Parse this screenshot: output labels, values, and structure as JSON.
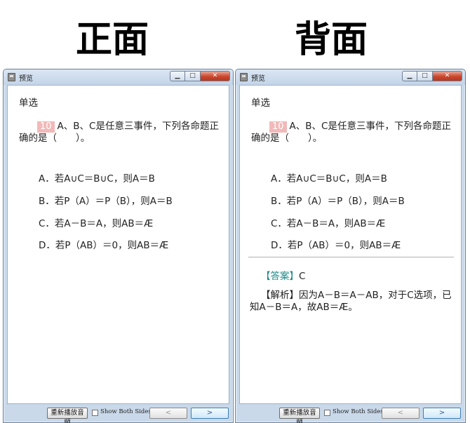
{
  "headings": {
    "front": "正面",
    "back": "背面"
  },
  "window": {
    "title": "预览",
    "controls": {
      "minimize": "▁",
      "maximize": "□",
      "close": "✕"
    }
  },
  "question": {
    "type_label": "单选",
    "number": "10",
    "stem": "A、B、C是任意三事件，下列各命题正确的是（　　）。",
    "options": [
      "A．若A∪C＝B∪C，则A＝B",
      "B．若P（A）＝P（B），则A＝B",
      "C．若A－B＝A，则AB＝Æ",
      "D．若P（AB）＝0，则AB＝Æ"
    ],
    "answer_tag": "【答案】",
    "answer": "C",
    "analysis_tag": "【解析】",
    "analysis": "因为A－B＝A－AB，对于C选项，已知A－B＝A，故AB＝Æ。"
  },
  "bottombar": {
    "replay_label": "重新播放音频",
    "show_both_label": "Show Both Sides",
    "prev_label": "<",
    "next_label": ">"
  },
  "colors": {
    "question_number_bg": "#f2b9b9",
    "answer_tag": "#1e8a8a",
    "close_button": "#c9462c",
    "window_frame": "#c9d9ea"
  }
}
